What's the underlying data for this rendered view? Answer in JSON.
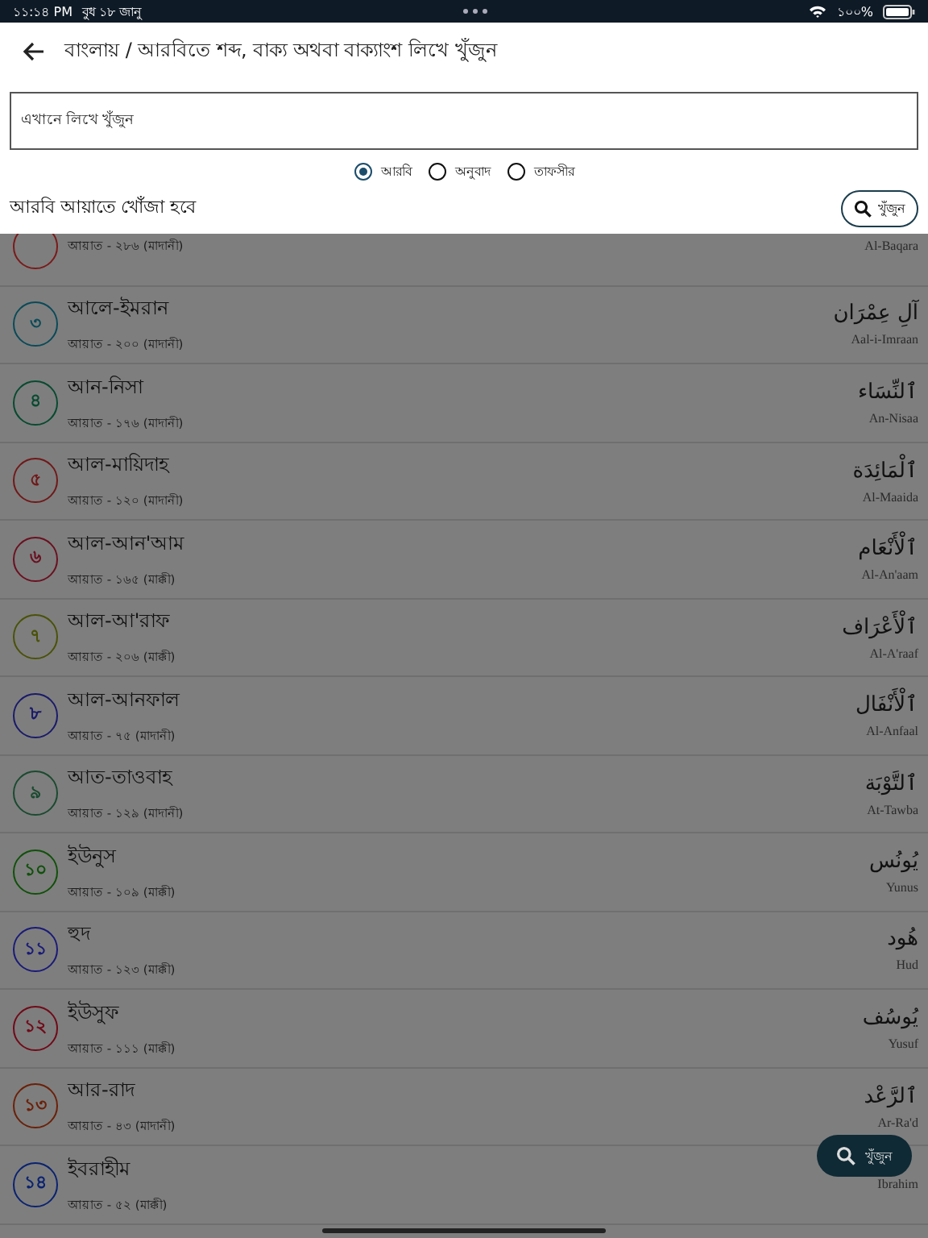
{
  "status_bar": {
    "time": "১১:১৪ PM",
    "date": "বুধ ১৮ জানু",
    "battery": "১০০%"
  },
  "header": {
    "title": "বাংলায় / আরবিতে শব্দ, বাক্য অথবা বাক্যাংশ লিখে খুঁজুন"
  },
  "search": {
    "placeholder": "এখানে লিখে খুঁজুন"
  },
  "search_modes": [
    {
      "label": "আরবি",
      "selected": true
    },
    {
      "label": "অনুবাদ",
      "selected": false
    },
    {
      "label": "তাফসীর",
      "selected": false
    }
  ],
  "mode_note": "আরবি আয়াতে খোঁজা হবে",
  "search_button": "খুঁজুন",
  "surahs": [
    {
      "ayat": "আয়াত - ২৮৬ (মাদানী)",
      "latin": "Al-Baqara",
      "color": "#7a1a1a"
    },
    {
      "number": "৩",
      "name": "আলে-ইমরান",
      "ayat": "আয়াত - ২০০ (মাদানী)",
      "arabic": "آلِ عِمْرَان",
      "latin": "Aal-i-Imraan",
      "color": "#0a4a58"
    },
    {
      "number": "৪",
      "name": "আন-নিসা",
      "ayat": "আয়াত - ১৭৬ (মাদানী)",
      "arabic": "ٱلنِّسَاء",
      "latin": "An-Nisaa",
      "color": "#084a30"
    },
    {
      "number": "৫",
      "name": "আল-মায়িদাহ",
      "ayat": "আয়াত - ১২০ (মাদানী)",
      "arabic": "ٱلْمَائِدَة",
      "latin": "Al-Maaida",
      "color": "#701818"
    },
    {
      "number": "৬",
      "name": "আল-আন'আম",
      "ayat": "আয়াত - ১৬৫ (মাক্কী)",
      "arabic": "ٱلْأَنْعَام",
      "latin": "Al-An'aam",
      "color": "#6a1020"
    },
    {
      "number": "৭",
      "name": "আল-আ'রাফ",
      "ayat": "আয়াত - ২০৬ (মাক্কী)",
      "arabic": "ٱلْأَعْرَاف",
      "latin": "Al-A'raaf",
      "color": "#4a5208"
    },
    {
      "number": "৮",
      "name": "আল-আনফাল",
      "ayat": "আয়াত - ৭৫ (মাদানী)",
      "arabic": "ٱلْأَنْفَال",
      "latin": "Al-Anfaal",
      "color": "#1a1a6a"
    },
    {
      "number": "৯",
      "name": "আত-তাওবাহ",
      "ayat": "আয়াত - ১২৯ (মাদানী)",
      "arabic": "ٱلتَّوْبَة",
      "latin": "At-Tawba",
      "color": "#1a4a30"
    },
    {
      "number": "১০",
      "name": "ইউনুস",
      "ayat": "আয়াত - ১০৯ (মাক্কী)",
      "arabic": "يُونُس",
      "latin": "Yunus",
      "color": "#10500a"
    },
    {
      "number": "১১",
      "name": "হুদ",
      "ayat": "আয়াত - ১২৩ (মাক্কী)",
      "arabic": "هُود",
      "latin": "Hud",
      "color": "#1a1a78"
    },
    {
      "number": "১২",
      "name": "ইউসুফ",
      "ayat": "আয়াত - ১১১ (মাক্কী)",
      "arabic": "يُوسُف",
      "latin": "Yusuf",
      "color": "#700a18"
    },
    {
      "number": "১৩",
      "name": "আর-রাদ",
      "ayat": "আয়াত - ৪৩ (মাদানী)",
      "arabic": "ٱلرَّعْد",
      "latin": "Ar-Ra'd",
      "color": "#6a2008"
    },
    {
      "number": "১৪",
      "name": "ইবরাহীম",
      "ayat": "আয়াত - ৫২ (মাক্কী)",
      "latin": "Ibrahim",
      "color": "#0a2270"
    }
  ],
  "fab": {
    "label": "খুঁজুন"
  }
}
